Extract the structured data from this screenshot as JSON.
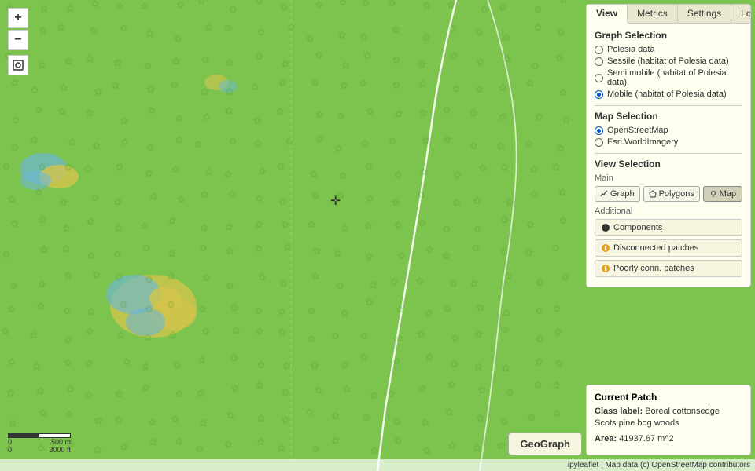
{
  "tabs": {
    "items": [
      "View",
      "Metrics",
      "Settings",
      "Log"
    ],
    "active": "View"
  },
  "graph_selection": {
    "title": "Graph Selection",
    "options": [
      {
        "label": "Polesia data",
        "selected": false
      },
      {
        "label": "Sessile (habitat of Polesia data)",
        "selected": false
      },
      {
        "label": "Semi mobile (habitat of Polesia data)",
        "selected": false
      },
      {
        "label": "Mobile (habitat of Polesia data)",
        "selected": true
      }
    ]
  },
  "map_selection": {
    "title": "Map Selection",
    "options": [
      {
        "label": "OpenStreetMap",
        "selected": true
      },
      {
        "label": "Esri.WorldImagery",
        "selected": false
      }
    ]
  },
  "view_selection": {
    "title": "View Selection",
    "main_label": "Main",
    "buttons": [
      {
        "label": "Graph",
        "icon": "graph-icon",
        "active": false
      },
      {
        "label": "Polygons",
        "icon": "polygon-icon",
        "active": false
      },
      {
        "label": "Map",
        "icon": "map-icon",
        "active": true
      }
    ],
    "additional_label": "Additional",
    "additional_buttons": [
      {
        "label": "Components",
        "icon": "dot-black"
      },
      {
        "label": "Disconnected patches",
        "icon": "dot-info"
      },
      {
        "label": "Poorly conn. patches",
        "icon": "dot-info"
      }
    ]
  },
  "current_patch": {
    "title": "Current Patch",
    "class_label_prefix": "Class label:",
    "class_label_value": "Boreal cottonsedge Scots pine bog woods",
    "area_prefix": "Area:",
    "area_value": "41937.67 m^2"
  },
  "geograph_button": "GeoGraph",
  "map_controls": {
    "zoom_in": "+",
    "zoom_out": "−",
    "locate": "⊙"
  },
  "scale": {
    "top": "500 m",
    "bottom": "3000 ft"
  },
  "attribution": "ipyleaflet | Map data (c) OpenStreetMap contributors"
}
